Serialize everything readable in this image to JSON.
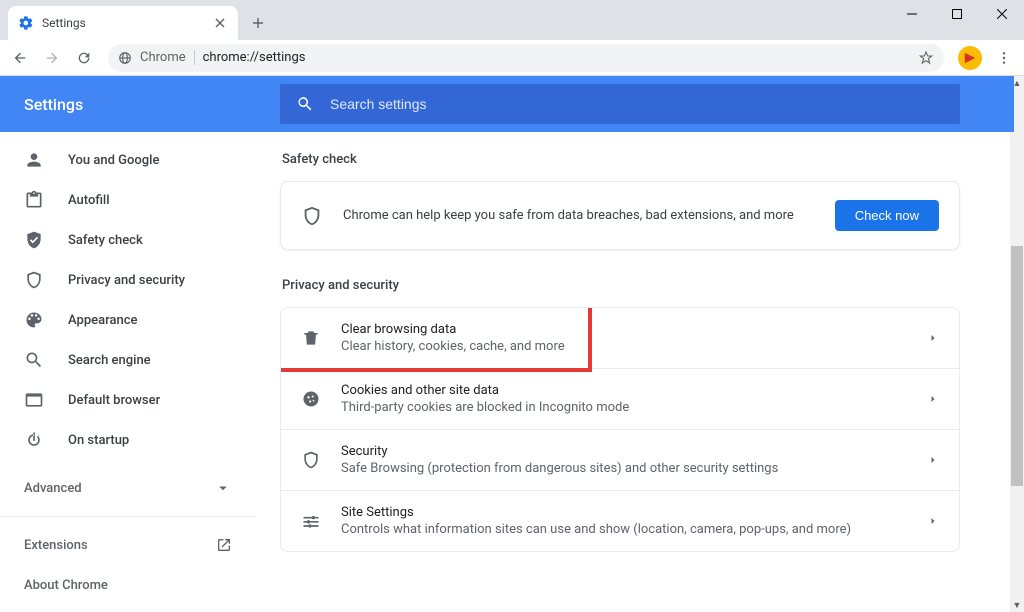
{
  "window": {
    "tab_title": "Settings"
  },
  "toolbar": {
    "secure_label": "Chrome",
    "url": "chrome://settings"
  },
  "header": {
    "title": "Settings",
    "search_placeholder": "Search settings"
  },
  "sidebar": {
    "items": [
      {
        "label": "You and Google"
      },
      {
        "label": "Autofill"
      },
      {
        "label": "Safety check"
      },
      {
        "label": "Privacy and security"
      },
      {
        "label": "Appearance"
      },
      {
        "label": "Search engine"
      },
      {
        "label": "Default browser"
      },
      {
        "label": "On startup"
      }
    ],
    "advanced_label": "Advanced",
    "extensions_label": "Extensions",
    "about_label": "About Chrome"
  },
  "main": {
    "safety_section_title": "Safety check",
    "safety_text": "Chrome can help keep you safe from data breaches, bad extensions, and more",
    "check_now_label": "Check now",
    "privacy_section_title": "Privacy and security",
    "rows": [
      {
        "title": "Clear browsing data",
        "sub": "Clear history, cookies, cache, and more"
      },
      {
        "title": "Cookies and other site data",
        "sub": "Third-party cookies are blocked in Incognito mode"
      },
      {
        "title": "Security",
        "sub": "Safe Browsing (protection from dangerous sites) and other security settings"
      },
      {
        "title": "Site Settings",
        "sub": "Controls what information sites can use and show (location, camera, pop-ups, and more)"
      }
    ]
  }
}
